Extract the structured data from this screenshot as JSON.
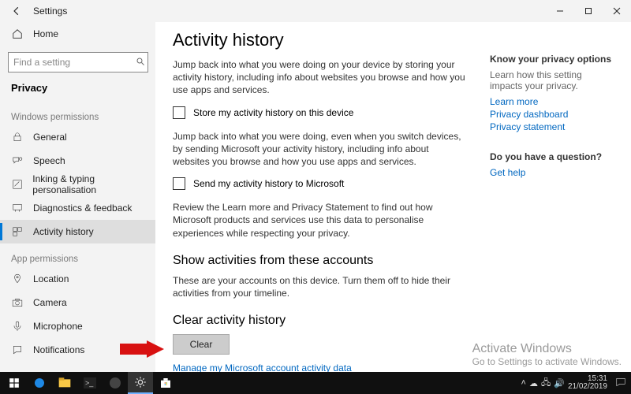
{
  "titlebar": {
    "app_title": "Settings",
    "home_label": "Home",
    "search_placeholder": "Find a setting",
    "category_label": "Privacy"
  },
  "sidebar": {
    "group1_label": "Windows permissions",
    "group1_items": [
      {
        "label": "General",
        "icon": "lock"
      },
      {
        "label": "Speech",
        "icon": "speech"
      },
      {
        "label": "Inking & typing personalisation",
        "icon": "ink"
      },
      {
        "label": "Diagnostics & feedback",
        "icon": "feedback"
      },
      {
        "label": "Activity history",
        "icon": "activity"
      }
    ],
    "group2_label": "App permissions",
    "group2_items": [
      {
        "label": "Location",
        "icon": "location"
      },
      {
        "label": "Camera",
        "icon": "camera"
      },
      {
        "label": "Microphone",
        "icon": "microphone"
      },
      {
        "label": "Notifications",
        "icon": "notifications"
      }
    ]
  },
  "main": {
    "heading": "Activity history",
    "para1": "Jump back into what you were doing on your device by storing your activity history, including info about websites you browse and how you use apps and services.",
    "check1": "Store my activity history on this device",
    "para2": "Jump back into what you were doing, even when you switch devices, by sending Microsoft your activity history, including info about websites you browse and how you use apps and services.",
    "check2": "Send my activity history to Microsoft",
    "para3": "Review the Learn more and Privacy Statement to find out how Microsoft products and services use this data to personalise experiences while respecting your privacy.",
    "subhead_accounts": "Show activities from these accounts",
    "para_accounts": "These are your accounts on this device. Turn them off to hide their activities from your timeline.",
    "subhead_clear": "Clear activity history",
    "clear_btn": "Clear",
    "manage_link": "Manage my Microsoft account activity data"
  },
  "right": {
    "kpo_head": "Know your privacy options",
    "kpo_text": "Learn how this setting impacts your privacy.",
    "link_learn": "Learn more",
    "link_dash": "Privacy dashboard",
    "link_stmt": "Privacy statement",
    "q_head": "Do you have a question?",
    "link_help": "Get help"
  },
  "watermark": {
    "line1": "Activate Windows",
    "line2": "Go to Settings to activate Windows."
  },
  "taskbar": {
    "time": "15:31",
    "date": "21/02/2019"
  }
}
